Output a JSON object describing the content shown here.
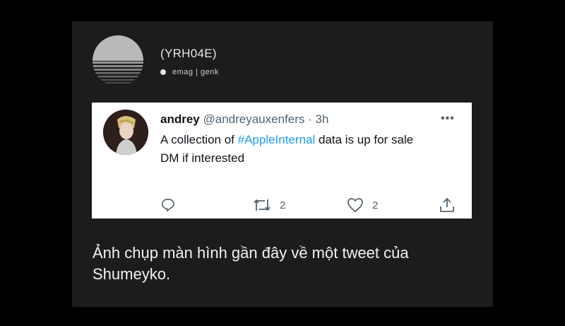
{
  "source": {
    "name": "(YRH04E)",
    "subtitle": "emag | genk"
  },
  "tweet": {
    "display_name": "andrey",
    "handle": "@andreyauxenfers",
    "separator": "·",
    "time": "3h",
    "more_label": "•••",
    "text_prefix": "A collection of ",
    "hashtag": "#AppleInternal",
    "text_suffix": " data is up for sale",
    "text_line2": "DM if interested",
    "reply_icon": "reply-icon",
    "retweet_icon": "retweet-icon",
    "retweet_count": "2",
    "like_icon": "heart-icon",
    "like_count": "2",
    "share_icon": "share-icon"
  },
  "caption": "Ảnh chụp màn hình gần đây về một tweet của Shumeyko.",
  "colors": {
    "background": "#000000",
    "card": "#1c1c1c",
    "hashtag": "#1d9bf0",
    "muted": "#536471"
  }
}
